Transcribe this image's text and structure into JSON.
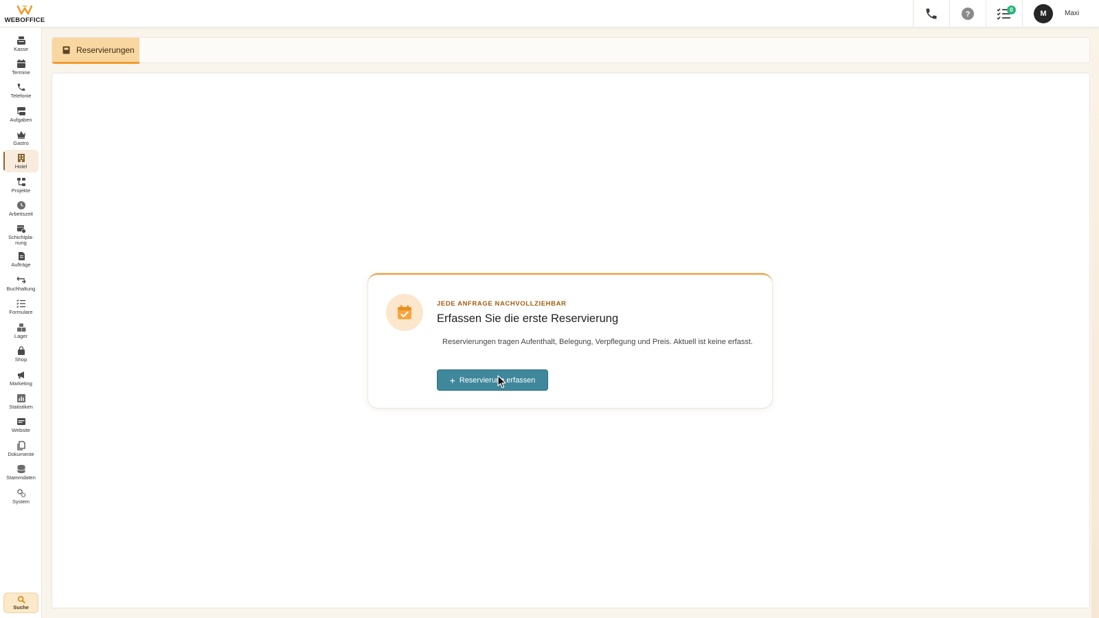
{
  "brand": {
    "name": "WEBOFFICE",
    "accent": "#f29a2e"
  },
  "topbar": {
    "badge_count": "0",
    "user_initial": "M",
    "user_name": "Maxi"
  },
  "sidebar": {
    "items": [
      {
        "label": "Kasse",
        "icon": "cash-register-icon"
      },
      {
        "label": "Termine",
        "icon": "calendar-icon"
      },
      {
        "label": "Telefonie",
        "icon": "phone-icon"
      },
      {
        "label": "Aufgaben",
        "icon": "tasks-icon"
      },
      {
        "label": "Gastro",
        "icon": "crown-icon"
      },
      {
        "label": "Hotel",
        "icon": "hotel-icon"
      },
      {
        "label": "Projekte",
        "icon": "project-icon"
      },
      {
        "label": "Arbeitszeit",
        "icon": "clock-icon"
      },
      {
        "label": "Schichtpla-\nnung",
        "icon": "shift-plan-icon"
      },
      {
        "label": "Aufträge",
        "icon": "document-icon"
      },
      {
        "label": "Buchhaltung",
        "icon": "arrows-icon"
      },
      {
        "label": "Formulare",
        "icon": "form-list-icon"
      },
      {
        "label": "Lager",
        "icon": "boxes-icon"
      },
      {
        "label": "Shop",
        "icon": "shopping-bag-icon"
      },
      {
        "label": "Marketing",
        "icon": "megaphone-icon"
      },
      {
        "label": "Statistiken",
        "icon": "chart-icon"
      },
      {
        "label": "Website",
        "icon": "browser-icon"
      },
      {
        "label": "Dokumente",
        "icon": "files-icon"
      },
      {
        "label": "Stammdaten",
        "icon": "database-icon"
      },
      {
        "label": "System",
        "icon": "gears-icon"
      }
    ],
    "search_label": "Suche"
  },
  "tabs": [
    {
      "label": "Reservierungen",
      "icon": "book-icon"
    }
  ],
  "empty_state": {
    "eyebrow": "JEDE ANFRAGE NACHVOLLZIEHBAR",
    "title": "Erfassen Sie die erste Reservierung",
    "description": "Reservierungen tragen Aufenthalt, Belegung, Verpflegung und Preis. Aktuell ist keine erfasst.",
    "cta_label": "Reservierung erfassen",
    "icon": "calendar-check-icon"
  }
}
